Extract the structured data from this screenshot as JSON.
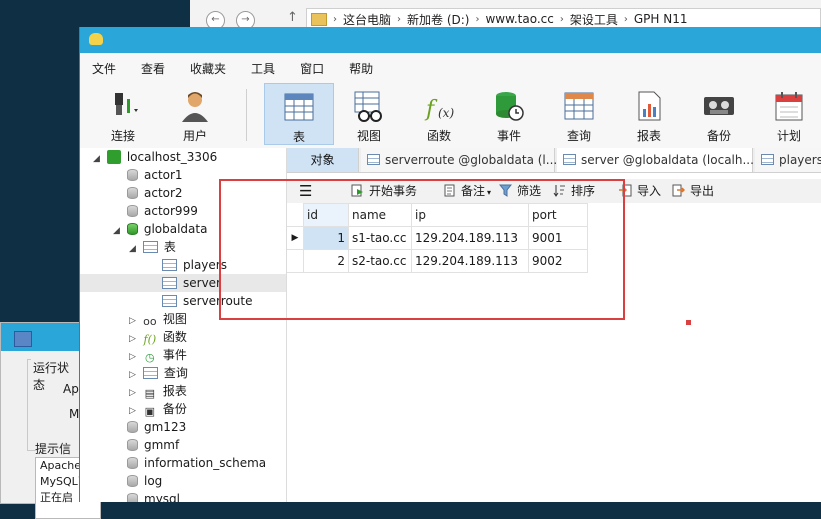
{
  "explorer": {
    "crumbs": [
      "这台电脑",
      "新加卷 (D:)",
      "www.tao.cc",
      "架设工具",
      "GPH N11"
    ]
  },
  "bg_window": {
    "group_title": "运行状态",
    "line1": "Ap",
    "line2": "M",
    "info_title": "提示信息",
    "info_lines": [
      "Apache",
      "MySQL已",
      "正在启"
    ]
  },
  "menu": [
    "文件",
    "查看",
    "收藏夹",
    "工具",
    "窗口",
    "帮助"
  ],
  "toolbar": {
    "connect": "连接",
    "user": "用户",
    "table": "表",
    "view": "视图",
    "function": "函数",
    "event": "事件",
    "query": "查询",
    "report": "报表",
    "backup": "备份",
    "schedule": "计划"
  },
  "tree": {
    "connection": "localhost_3306",
    "databases": [
      "actor1",
      "actor2",
      "actor999",
      "globaldata"
    ],
    "tables_group": "表",
    "tables": [
      "players",
      "server",
      "serverroute"
    ],
    "groups": [
      "视图",
      "函数",
      "事件",
      "查询",
      "报表",
      "备份"
    ],
    "more_databases": [
      "gm123",
      "gmmf",
      "information_schema",
      "log",
      "mysql"
    ]
  },
  "tabs": {
    "objects": "对象",
    "t1": "serverroute @globaldata (l...",
    "t2": "server @globaldata (localh...",
    "t3": "players"
  },
  "grid_toolbar": {
    "begin_tx": "开始事务",
    "note": "备注",
    "filter": "筛选",
    "sort": "排序",
    "import": "导入",
    "export": "导出"
  },
  "grid": {
    "columns": [
      "id",
      "name",
      "ip",
      "port"
    ],
    "rows": [
      [
        "1",
        "s1-tao.cc",
        "129.204.189.113",
        "9001"
      ],
      [
        "2",
        "s2-tao.cc",
        "129.204.189.113",
        "9002"
      ]
    ]
  },
  "colors": {
    "titlebar": "#2aa7d8",
    "highlight": "#cfe3f5",
    "annotation": "#d9403f"
  }
}
